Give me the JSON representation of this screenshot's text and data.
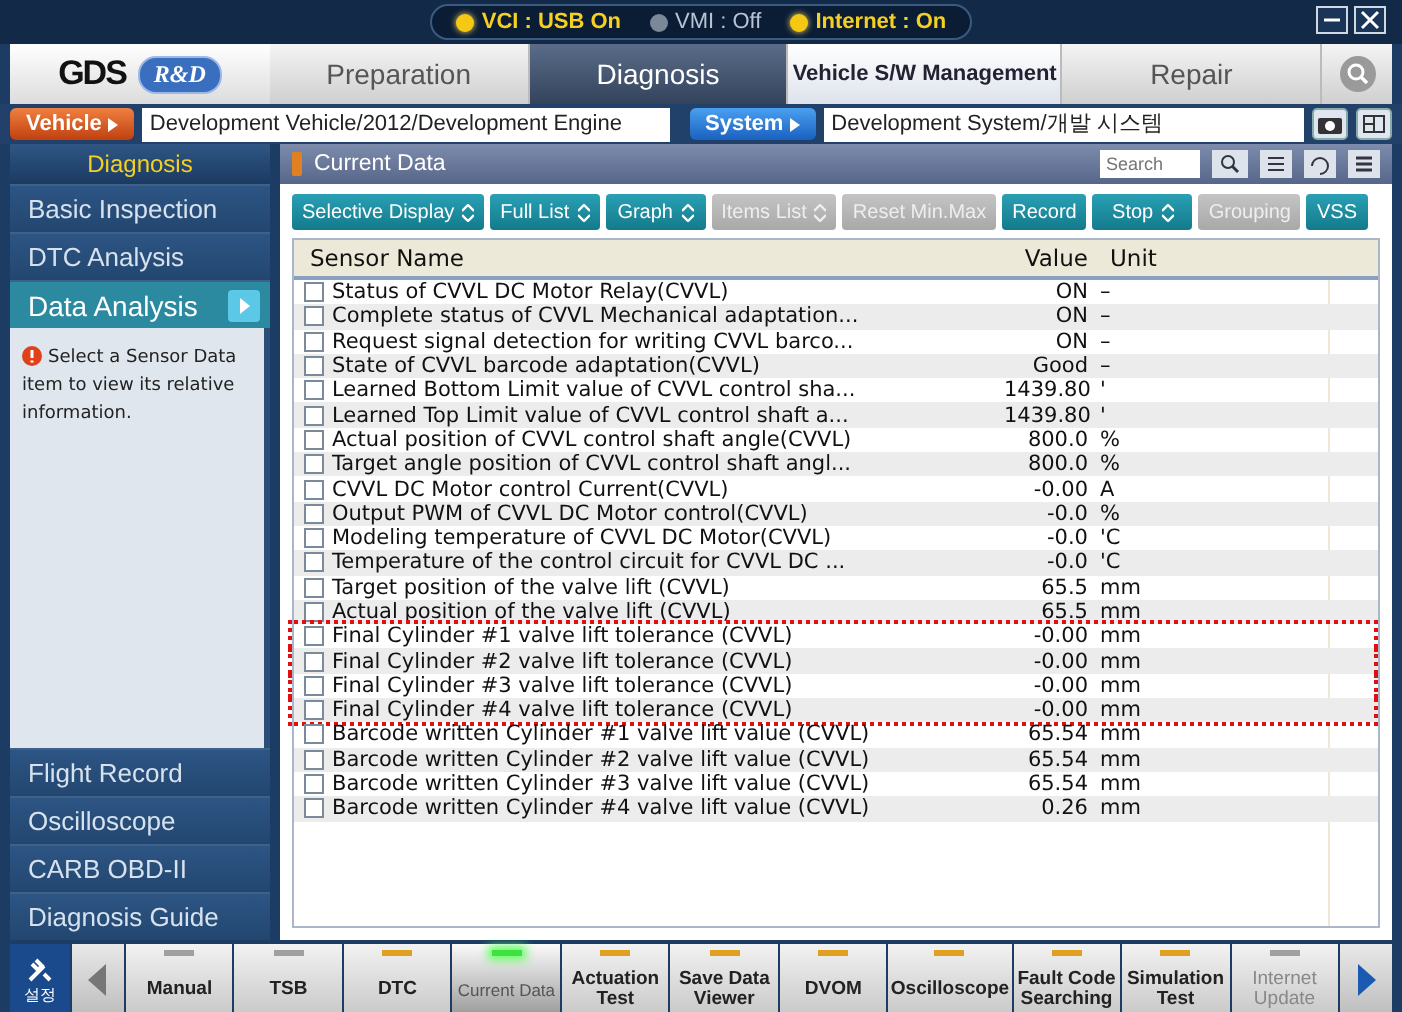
{
  "status": [
    {
      "label": "VCI : USB On",
      "on": true
    },
    {
      "label": "VMI : Off",
      "on": false
    },
    {
      "label": "Internet : On",
      "on": true
    }
  ],
  "logo": {
    "brand": "GDS",
    "badge": "R&D"
  },
  "tabs": [
    {
      "label": "Preparation",
      "selected": false,
      "kind": "normal"
    },
    {
      "label": "Diagnosis",
      "selected": true,
      "kind": "normal"
    },
    {
      "label": "Vehicle S/W Management",
      "selected": false,
      "kind": "compact"
    },
    {
      "label": "Repair",
      "selected": false,
      "kind": "normal"
    }
  ],
  "vehicle": {
    "label": "Vehicle",
    "value": "Development Vehicle/2012/Development Engine"
  },
  "system": {
    "label": "System",
    "value": "Development System/개발 시스템"
  },
  "sidebar": {
    "header": "Diagnosis",
    "items": [
      {
        "label": "Basic Inspection",
        "selected": false
      },
      {
        "label": "DTC Analysis",
        "selected": false
      },
      {
        "label": "Data Analysis",
        "selected": true
      }
    ],
    "info": "Select a Sensor Data item to view its relative information.",
    "lower_items": [
      {
        "label": "Flight Record"
      },
      {
        "label": "Oscilloscope"
      },
      {
        "label": "CARB OBD-II"
      },
      {
        "label": "Diagnosis Guide"
      }
    ]
  },
  "panel": {
    "title": "Current Data",
    "search_placeholder": "Search"
  },
  "toolbar": [
    {
      "label": "Selective Display",
      "dropdown": true,
      "disabled": false
    },
    {
      "label": "Full List",
      "dropdown": true,
      "disabled": false
    },
    {
      "label": "Graph",
      "dropdown": true,
      "disabled": false
    },
    {
      "label": "Items List",
      "dropdown": true,
      "disabled": true
    },
    {
      "label": "Reset Min.Max",
      "dropdown": false,
      "disabled": true
    },
    {
      "label": "Record",
      "dropdown": false,
      "disabled": false
    },
    {
      "label": "Stop",
      "dropdown": true,
      "disabled": false
    },
    {
      "label": "Grouping",
      "dropdown": false,
      "disabled": true
    },
    {
      "label": "VSS",
      "dropdown": false,
      "disabled": false
    }
  ],
  "table": {
    "columns": [
      "Sensor Name",
      "Value",
      "Unit"
    ],
    "rows": [
      {
        "name": "Status of CVVL DC Motor Relay(CVVL)",
        "value": "ON",
        "unit": "–",
        "checked": false,
        "highlighted": false
      },
      {
        "name": "Complete status of CVVL Mechanical adaptation...",
        "value": "ON",
        "unit": "–",
        "checked": false,
        "highlighted": false
      },
      {
        "name": "Request signal detection for writing CVVL barco...",
        "value": "ON",
        "unit": "–",
        "checked": false,
        "highlighted": false
      },
      {
        "name": "State of CVVL barcode adaptation(CVVL)",
        "value": "Good",
        "unit": "–",
        "checked": false,
        "highlighted": false
      },
      {
        "name": "Learned Bottom Limit value of CVVL control sha...",
        "value": "1439.80",
        "unit": "'",
        "checked": false,
        "highlighted": false
      },
      {
        "name": "Learned Top Limit value of CVVL control shaft a...",
        "value": "1439.80",
        "unit": "'",
        "checked": false,
        "highlighted": false
      },
      {
        "name": "Actual position of CVVL control shaft angle(CVVL)",
        "value": "800.0",
        "unit": "%",
        "checked": false,
        "highlighted": false
      },
      {
        "name": "Target angle position of CVVL control shaft angl...",
        "value": "800.0",
        "unit": "%",
        "checked": false,
        "highlighted": false
      },
      {
        "name": "CVVL DC Motor control Current(CVVL)",
        "value": "-0.00",
        "unit": "A",
        "checked": false,
        "highlighted": false
      },
      {
        "name": "Output PWM of CVVL DC Motor control(CVVL)",
        "value": "-0.0",
        "unit": "%",
        "checked": false,
        "highlighted": false
      },
      {
        "name": "Modeling temperature of CVVL DC Motor(CVVL)",
        "value": "-0.0",
        "unit": "'C",
        "checked": false,
        "highlighted": false
      },
      {
        "name": "Temperature of the control circuit for CVVL DC ...",
        "value": "-0.0",
        "unit": "'C",
        "checked": false,
        "highlighted": false
      },
      {
        "name": "Target position of the valve lift (CVVL)",
        "value": "65.5",
        "unit": "mm",
        "checked": false,
        "highlighted": false
      },
      {
        "name": "Actual position of the valve lift (CVVL)",
        "value": "65.5",
        "unit": "mm",
        "checked": false,
        "highlighted": false
      },
      {
        "name": "Final Cylinder #1 valve lift tolerance (CVVL)",
        "value": "-0.00",
        "unit": "mm",
        "checked": false,
        "highlighted": true
      },
      {
        "name": "Final Cylinder #2 valve lift tolerance (CVVL)",
        "value": "-0.00",
        "unit": "mm",
        "checked": false,
        "highlighted": true
      },
      {
        "name": "Final Cylinder #3 valve lift tolerance (CVVL)",
        "value": "-0.00",
        "unit": "mm",
        "checked": false,
        "highlighted": true
      },
      {
        "name": "Final Cylinder #4 valve lift tolerance (CVVL)",
        "value": "-0.00",
        "unit": "mm",
        "checked": false,
        "highlighted": true
      },
      {
        "name": "Barcode written Cylinder #1 valve lift value (CVVL)",
        "value": "65.54",
        "unit": "mm",
        "checked": false,
        "highlighted": false
      },
      {
        "name": "Barcode written Cylinder #2 valve lift value (CVVL)",
        "value": "65.54",
        "unit": "mm",
        "checked": false,
        "highlighted": false
      },
      {
        "name": "Barcode written Cylinder #3 valve lift value (CVVL)",
        "value": "65.54",
        "unit": "mm",
        "checked": false,
        "highlighted": false
      },
      {
        "name": "Barcode written Cylinder #4 valve lift value (CVVL)",
        "value": "0.26",
        "unit": "mm",
        "checked": false,
        "highlighted": false
      }
    ]
  },
  "settings_label": "설정",
  "dock": [
    {
      "label": "Manual",
      "color": "#a0a0a0",
      "selected": false,
      "disabled": false
    },
    {
      "label": "TSB",
      "color": "#a0a0a0",
      "selected": false,
      "disabled": false
    },
    {
      "label": "DTC",
      "color": "#e0a020",
      "selected": false,
      "disabled": false
    },
    {
      "label": "Current Data",
      "color": "#40e040",
      "selected": true,
      "disabled": false
    },
    {
      "label": "Actuation Test",
      "color": "#e0a020",
      "selected": false,
      "disabled": false
    },
    {
      "label": "Save Data Viewer",
      "color": "#e0a020",
      "selected": false,
      "disabled": false
    },
    {
      "label": "DVOM",
      "color": "#e0a020",
      "selected": false,
      "disabled": false
    },
    {
      "label": "Oscilloscope",
      "color": "#e0a020",
      "selected": false,
      "disabled": false
    },
    {
      "label": "Fault Code Searching",
      "color": "#e0a020",
      "selected": false,
      "disabled": false
    },
    {
      "label": "Simulation Test",
      "color": "#e0a020",
      "selected": false,
      "disabled": false
    },
    {
      "label": "Internet Update",
      "color": "#a0a0a0",
      "selected": false,
      "disabled": true
    }
  ]
}
